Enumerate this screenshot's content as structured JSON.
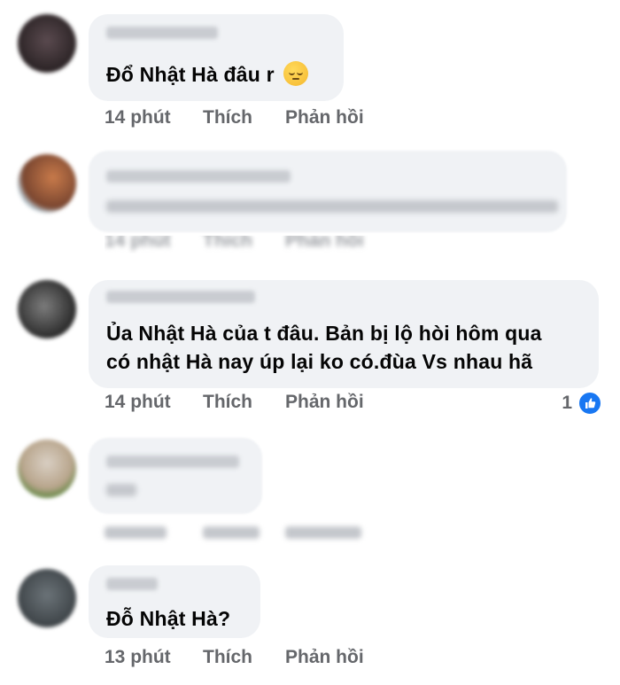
{
  "comments": [
    {
      "text_lines": [
        "Đổ Nhật Hà đâu r"
      ],
      "emoji": "pensive-face",
      "time": "14 phút",
      "like": "Thích",
      "reply": "Phản hồi"
    },
    {
      "time": "14 phút",
      "like": "Thích",
      "reply": "Phản hồi"
    },
    {
      "text_lines": [
        "Ủa Nhật Hà của t đâu. Bản bị lộ hòi hôm qua",
        "có nhật Hà nay úp lại ko có.đùa Vs nhau hã"
      ],
      "time": "14 phút",
      "like": "Thích",
      "reply": "Phản hồi",
      "reaction_count": "1",
      "reaction_icon": "like-icon"
    },
    {
      "time": "",
      "like": "",
      "reply": ""
    },
    {
      "text_lines": [
        "Đỗ Nhật Hà?"
      ],
      "time": "13 phút",
      "like": "Thích",
      "reply": "Phản hồi"
    }
  ],
  "colors": {
    "bubble": "#f0f2f5",
    "action_text": "#65676b",
    "like_blue": "#1877f2"
  }
}
